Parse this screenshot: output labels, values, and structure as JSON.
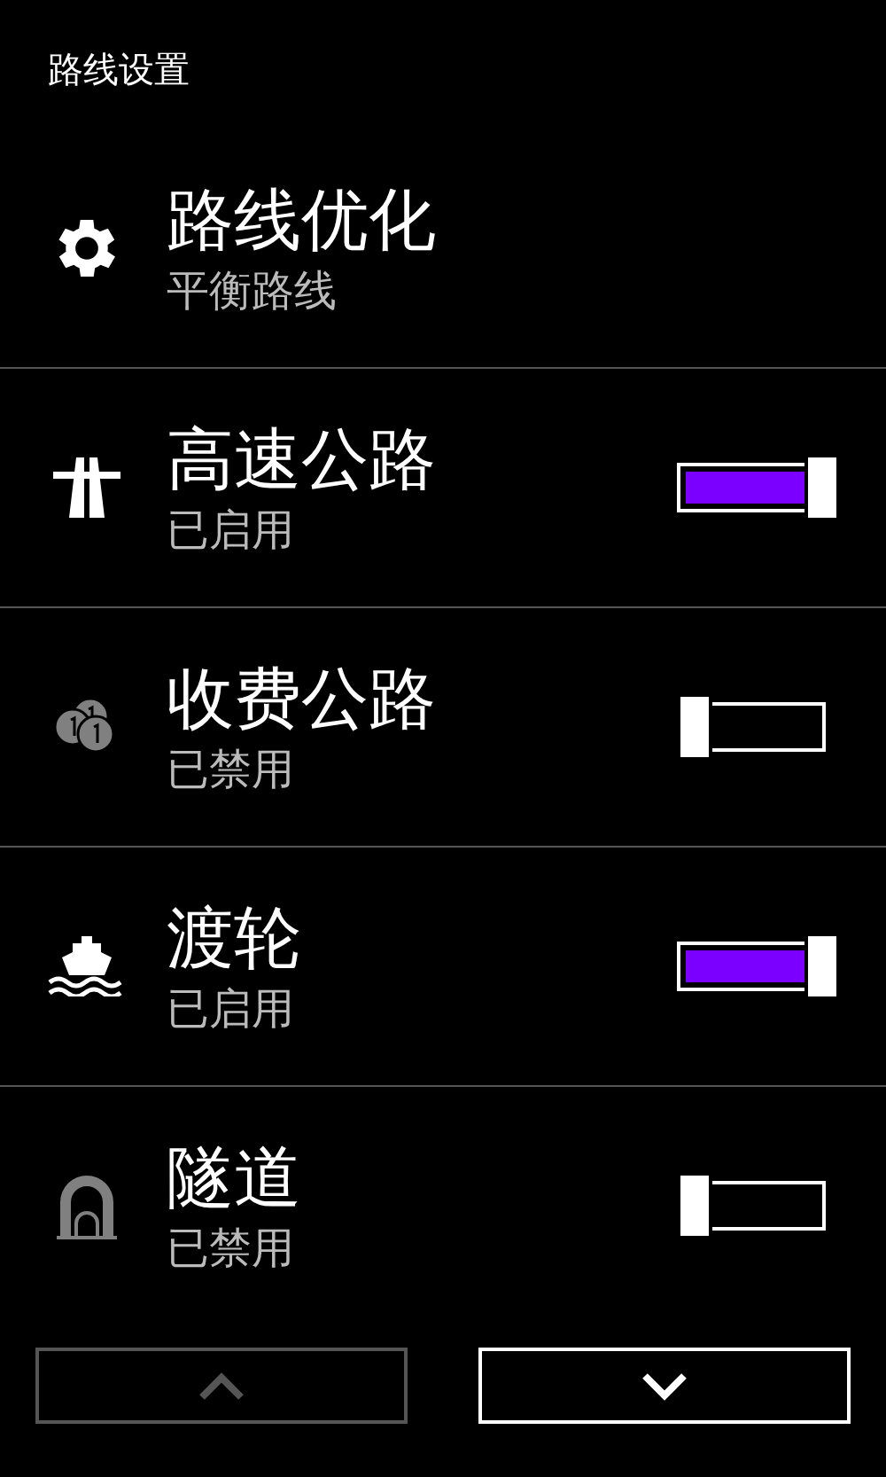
{
  "title": "路线设置",
  "items": [
    {
      "kind": "option",
      "label": "路线优化",
      "value": "平衡路线"
    },
    {
      "kind": "toggle",
      "label": "高速公路",
      "value": "已启用",
      "on": true
    },
    {
      "kind": "toggle",
      "label": "收费公路",
      "value": "已禁用",
      "on": false
    },
    {
      "kind": "toggle",
      "label": "渡轮",
      "value": "已启用",
      "on": true
    },
    {
      "kind": "toggle",
      "label": "隧道",
      "value": "已禁用",
      "on": false
    }
  ],
  "nav": [
    {
      "disabled": true
    },
    {
      "disabled": false
    }
  ]
}
